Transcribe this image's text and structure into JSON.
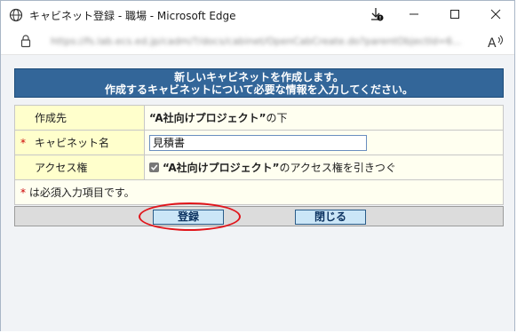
{
  "window": {
    "title": "キャビネット登録 - 職場 - Microsoft Edge"
  },
  "address_bar": {
    "url": "https://fs.lab.ecs.ed.jp/cadm/?/docs/cabinet/OpenCabCreate.do?parentObjectId=6..."
  },
  "form": {
    "header_line1": "新しいキャビネットを作成します。",
    "header_line2": "作成するキャビネットについて必要な情報を入力してください。",
    "rows": [
      {
        "label": "作成先",
        "value_bold": "“A社向けプロジェクト”",
        "value_suffix": "の下"
      },
      {
        "required_mark": "*",
        "label": "キャビネット名",
        "input_value": "見積書"
      },
      {
        "label": "アクセス権",
        "value_bold": "“A社向けプロジェクト”",
        "value_suffix": "のアクセス権を引きつぐ",
        "checked": true
      }
    ],
    "note_mark": "*",
    "note_text": "は必須入力項目です。"
  },
  "buttons": {
    "register_label": "登録",
    "close_label": "閉じる"
  },
  "colors": {
    "header_bg": "#336699",
    "label_bg": "#ffffcc",
    "button_bg": "#cbe6f7",
    "highlight": "#e0151b",
    "required": "#cc0000"
  }
}
